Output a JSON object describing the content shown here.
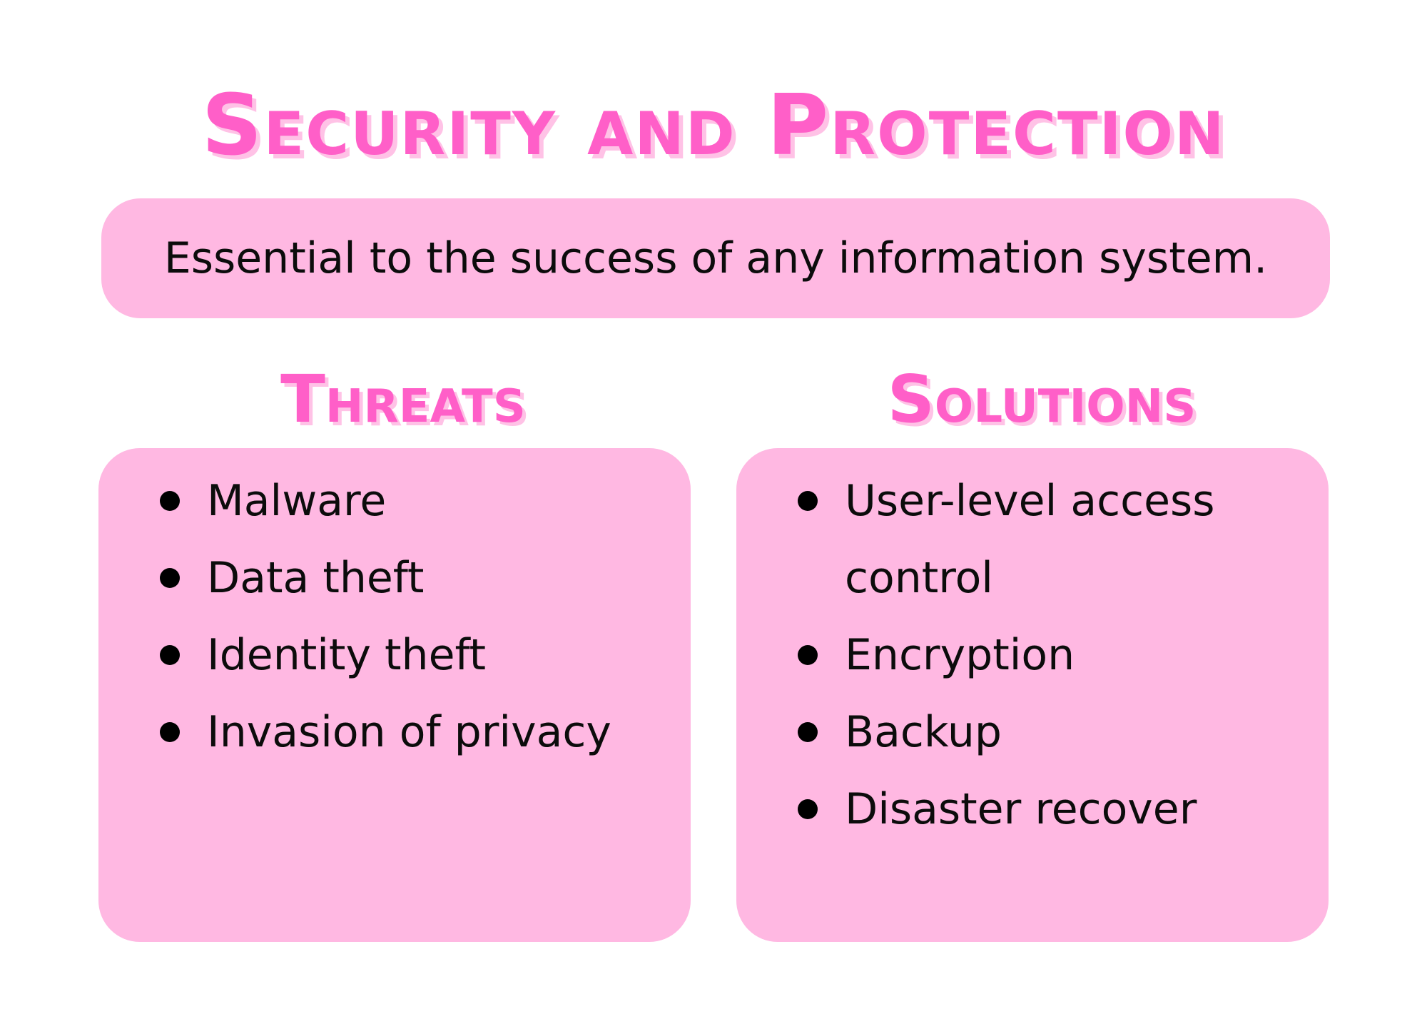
{
  "title": "Security and Protection",
  "subtitle": "Essential to the success of any information system.",
  "threats": {
    "heading": "Threats",
    "items": [
      "Malware",
      "Data theft",
      "Identity theft",
      "Invasion of privacy"
    ]
  },
  "solutions": {
    "heading": "Solutions",
    "items": [
      "User-level access control",
      "Encryption",
      "Backup",
      "Disaster recover"
    ]
  },
  "colors": {
    "accent": "#ff5fc8",
    "accent_shadow": "#ffc2e6",
    "card": "#ffb8e2",
    "text": "#0c0c0c"
  }
}
